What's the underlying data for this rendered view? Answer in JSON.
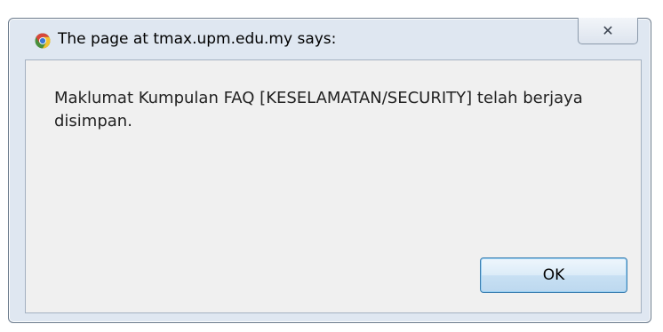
{
  "dialog": {
    "title": "The page at tmax.upm.edu.my says:",
    "title_icon": "chrome-icon",
    "close_glyph": "✕",
    "message": "Maklumat Kumpulan FAQ [KESELAMATAN/SECURITY] telah berjaya disimpan.",
    "ok_label": "OK"
  },
  "colors": {
    "frame": "#dfe7f1",
    "client": "#f0f0f0",
    "button_border": "#3c7fb1"
  }
}
